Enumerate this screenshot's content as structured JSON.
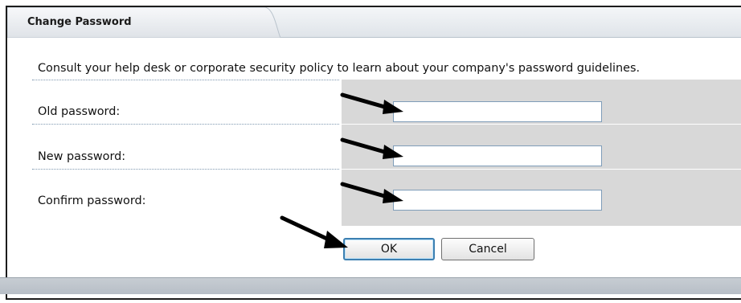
{
  "dialog": {
    "title": "Change Password",
    "intro": "Consult your help desk or corporate security policy to learn about your company's password guidelines."
  },
  "form": {
    "fields": [
      {
        "label": "Old password:",
        "value": ""
      },
      {
        "label": "New password:",
        "value": ""
      },
      {
        "label": "Confirm password:",
        "value": ""
      }
    ]
  },
  "buttons": {
    "ok": "OK",
    "cancel": "Cancel"
  },
  "colors": {
    "panel_gray": "#d8d8d8",
    "field_border": "#7f9db9",
    "ok_focus": "#3c7fb1",
    "arrow": "#000000"
  },
  "icons": [
    "arrow-pointer-icon"
  ]
}
